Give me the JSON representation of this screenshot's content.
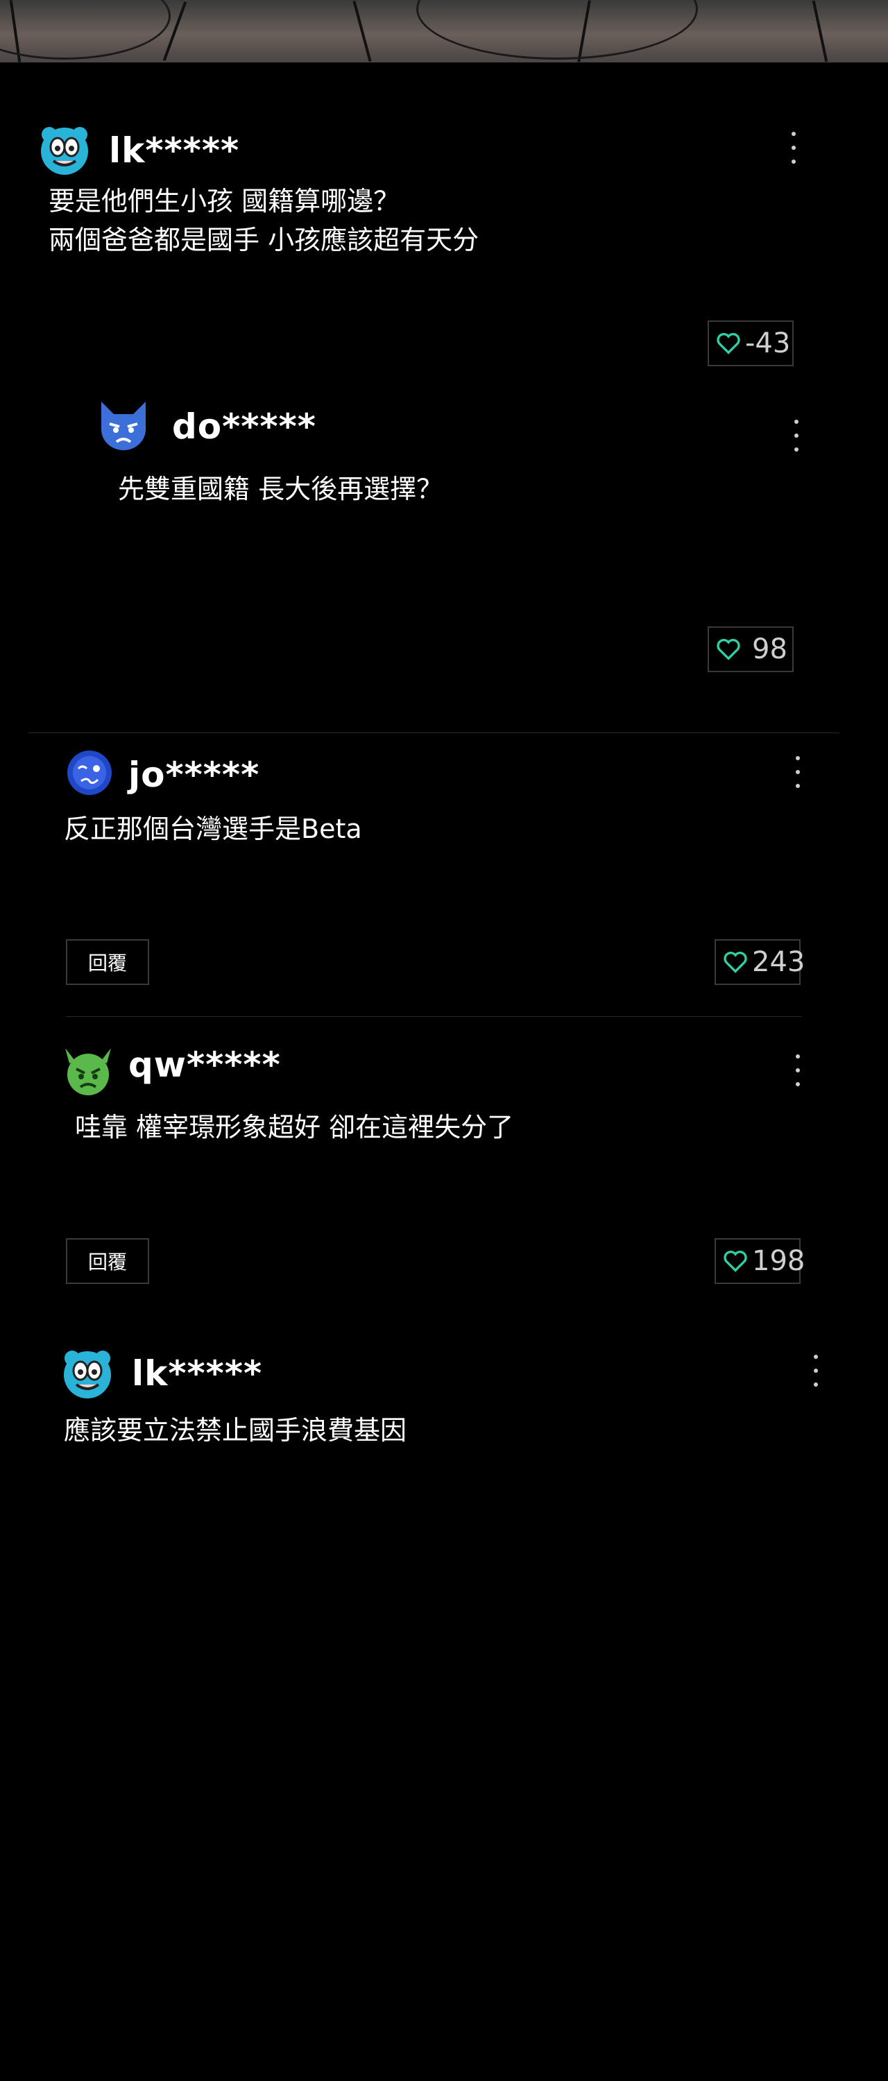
{
  "comments": [
    {
      "username": "lk*****",
      "text": "要是他們生小孩 國籍算哪邊？\n兩個爸爸都是國手 小孩應該超有天分",
      "likes": "-43",
      "avatar": "blue-skull-face-icon"
    },
    {
      "username": "do*****",
      "text": "先雙重國籍 長大後再選擇？",
      "likes": "98",
      "avatar": "pouting-blue-cat-icon"
    },
    {
      "username": "jo*****",
      "text": "反正那個台灣選手是Beta",
      "likes": "243",
      "reply": "回覆",
      "avatar": "woozy-blue-face-icon"
    },
    {
      "username": "qw*****",
      "text": "哇靠 權宰璟形象超好 卻在這裡失分了",
      "likes": "198",
      "reply": "回覆",
      "avatar": "green-angry-devil-icon"
    },
    {
      "username": "lk*****",
      "text": "應該要立法禁止國手浪費基因",
      "avatar": "blue-skull-face-icon"
    }
  ],
  "colors": {
    "background": "#000000",
    "heart": "#2fd0a5",
    "border": "#3a3a3a"
  }
}
